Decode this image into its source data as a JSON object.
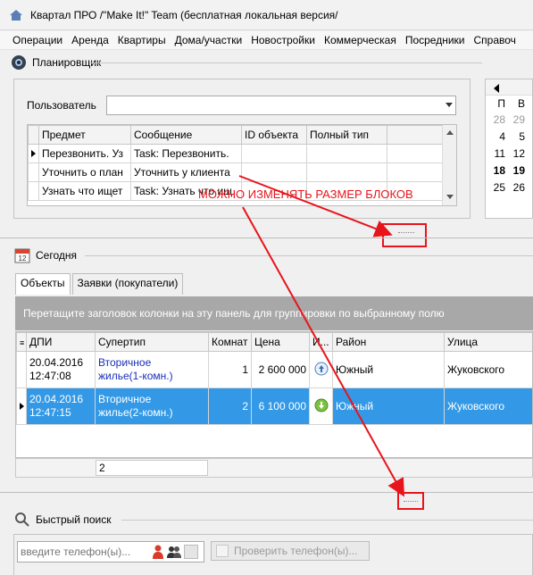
{
  "window": {
    "title": "Квартал ПРО /\"Make It!\" Team (бесплатная локальная версия/"
  },
  "menu": [
    "Операции",
    "Аренда",
    "Квартиры",
    "Дома/участки",
    "Новостройки",
    "Коммерческая",
    "Посредники",
    "Справоч"
  ],
  "planner": {
    "title": "Планировщик",
    "user_label": "Пользователь",
    "user_value": "",
    "columns": [
      "Предмет",
      "Сообщение",
      "ID объекта",
      "Полный тип"
    ],
    "rows": [
      {
        "subject": "Перезвонить. Уз",
        "message": "Task: Перезвонить.",
        "id": "",
        "type": ""
      },
      {
        "subject": "Уточнить о план",
        "message": "Уточнить у клиента",
        "id": "",
        "type": ""
      },
      {
        "subject": "Узнать что ищет",
        "message": "Task: Узнать что ищ",
        "id": "",
        "type": ""
      }
    ]
  },
  "calendar": {
    "weekday": "П",
    "weekday2": "В",
    "rows": [
      {
        "d1": "28",
        "d2": "29",
        "muted": true,
        "bold": false
      },
      {
        "d1": "4",
        "d2": "5",
        "muted": false,
        "bold": false
      },
      {
        "d1": "11",
        "d2": "12",
        "muted": false,
        "bold": false
      },
      {
        "d1": "18",
        "d2": "19",
        "muted": false,
        "bold": true
      },
      {
        "d1": "25",
        "d2": "26",
        "muted": false,
        "bold": false
      }
    ]
  },
  "annotation": {
    "text": "МОЖНО ИЗМЕНЯТЬ РАЗМЕР БЛОКОВ",
    "color": "#e8141b"
  },
  "today": {
    "title": "Сегодня",
    "calendar_badge": "12",
    "tabs": [
      "Объекты",
      "Заявки (покупатели)"
    ],
    "group_hint": "Перетащите заголовок колонки на эту панель для группировки по выбранному полю",
    "columns": [
      "ДПИ",
      "Супертип",
      "Комнат",
      "Цена",
      "И...",
      "Район",
      "Улица"
    ],
    "rows": [
      {
        "date": "20.04.2016",
        "time": "12:47:08",
        "type1": "Вторичное",
        "type2": "жилье(1-комн.)",
        "rooms": "1",
        "price": "2 600 000",
        "icon": "arrow-up",
        "district": "Южный",
        "street": "Жуковского",
        "selected": false
      },
      {
        "date": "20.04.2016",
        "time": "12:47:15",
        "type1": "Вторичное",
        "type2": "жилье(2-комн.)",
        "rooms": "2",
        "price": "6 100 000",
        "icon": "arrow-down",
        "district": "Южный",
        "street": "Жуковского",
        "selected": true
      }
    ],
    "footer_count": "2"
  },
  "quick_search": {
    "title": "Быстрый поиск",
    "phone_placeholder": "введите телефон(ы)...",
    "check_button": "Проверить телефон(ы)..."
  }
}
